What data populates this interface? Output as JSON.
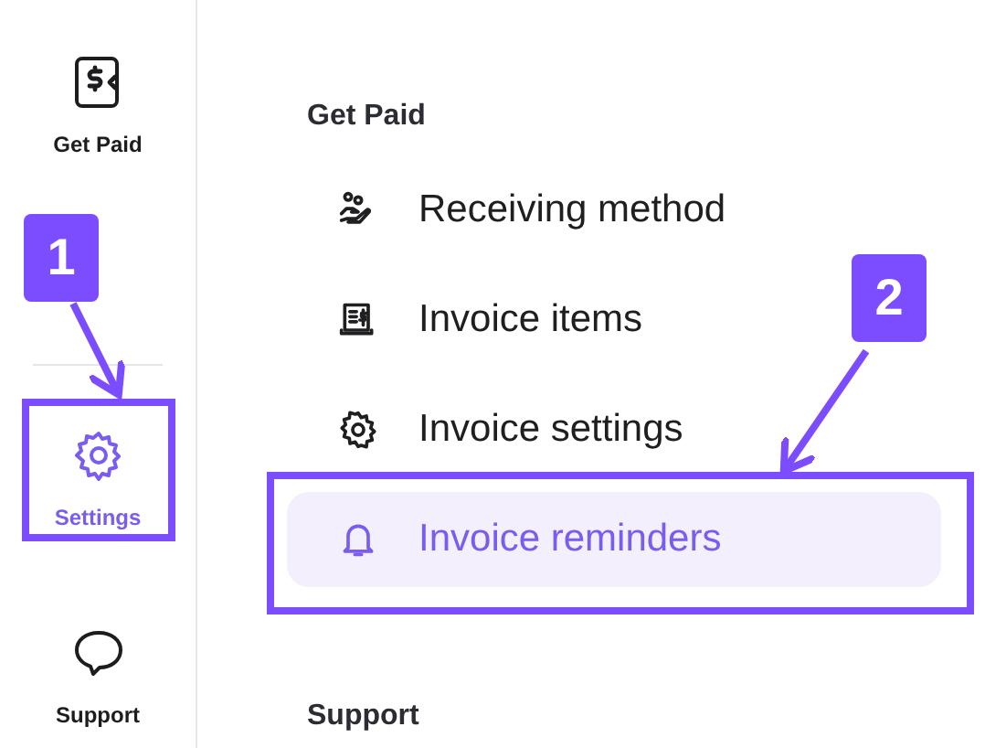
{
  "sidebar": {
    "items": [
      {
        "label": "Get Paid",
        "selected": false
      },
      {
        "label": "Settings",
        "selected": true
      },
      {
        "label": "Support",
        "selected": false
      }
    ]
  },
  "menu": {
    "sections": [
      {
        "heading": "Get Paid",
        "items": [
          {
            "label": "Receiving method",
            "selected": false
          },
          {
            "label": "Invoice items",
            "selected": false
          },
          {
            "label": "Invoice settings",
            "selected": false
          },
          {
            "label": "Invoice reminders",
            "selected": true
          }
        ]
      },
      {
        "heading": "Support"
      }
    ]
  },
  "annotations": [
    {
      "number": "1"
    },
    {
      "number": "2"
    }
  ]
}
